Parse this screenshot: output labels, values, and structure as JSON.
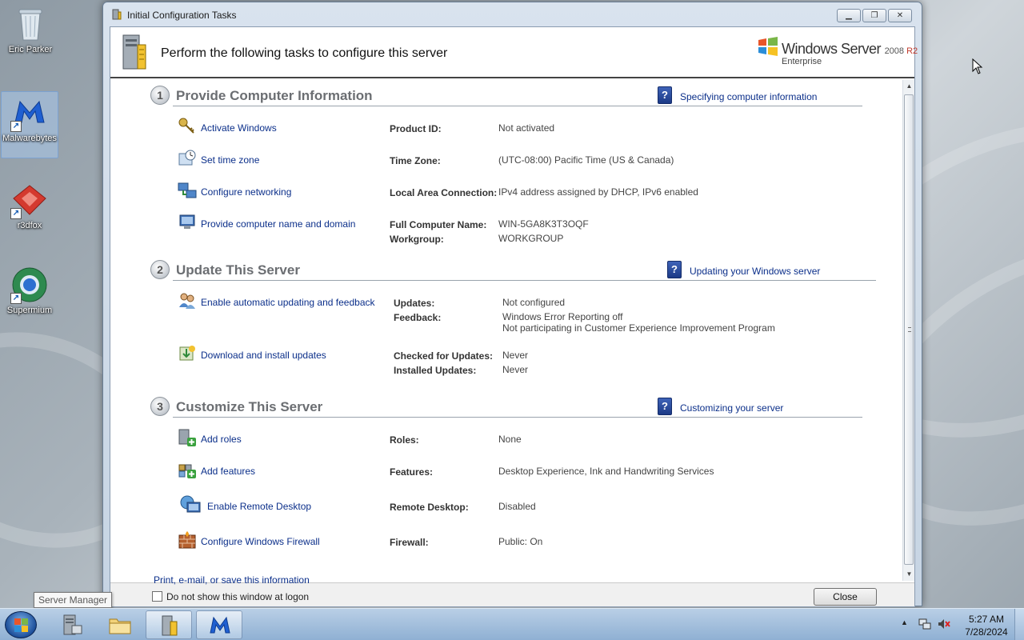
{
  "desktop": {
    "icons": [
      {
        "label": "Eric Parker",
        "icon": "recycle-bin-icon"
      },
      {
        "label": "Malwarebytes",
        "icon": "malwarebytes-icon"
      },
      {
        "label": "r3dfox",
        "icon": "r3dfox-icon"
      },
      {
        "label": "Supermium",
        "icon": "supermium-icon"
      }
    ]
  },
  "window": {
    "title": "Initial Configuration Tasks",
    "heading": "Perform the following tasks to configure this server",
    "brand": {
      "name": "Windows Server",
      "version_prefix": "2008",
      "version_suffix": "R2",
      "edition": "Enterprise"
    },
    "sections": [
      {
        "number": "1",
        "title": "Provide Computer Information",
        "help_link": "Specifying computer information",
        "tasks": [
          {
            "link": "Activate Windows",
            "icon": "keys-icon",
            "props": [
              {
                "label": "Product ID:",
                "value": "Not activated"
              }
            ]
          },
          {
            "link": "Set time zone",
            "icon": "clock-icon",
            "props": [
              {
                "label": "Time Zone:",
                "value": "(UTC-08:00) Pacific Time (US & Canada)"
              }
            ]
          },
          {
            "link": "Configure networking",
            "icon": "network-icon",
            "props": [
              {
                "label": "Local Area Connection:",
                "value": "IPv4 address assigned by DHCP, IPv6 enabled"
              }
            ]
          },
          {
            "link": "Provide computer name and domain",
            "icon": "computer-icon",
            "props": [
              {
                "label": "Full Computer Name:",
                "value": "WIN-5GA8K3T3OQF"
              },
              {
                "label": "Workgroup:",
                "value": "WORKGROUP"
              }
            ]
          }
        ]
      },
      {
        "number": "2",
        "title": "Update This Server",
        "help_link": "Updating your Windows server",
        "tasks": [
          {
            "link": "Enable automatic updating and feedback",
            "icon": "users-update-icon",
            "props": [
              {
                "label": "Updates:",
                "value": "Not configured"
              },
              {
                "label": "Feedback:",
                "value": "Windows Error Reporting off"
              }
            ],
            "extra": "Not participating in Customer Experience Improvement Program"
          },
          {
            "link": "Download and install updates",
            "icon": "download-updates-icon",
            "props": [
              {
                "label": "Checked for Updates:",
                "value": "Never"
              },
              {
                "label": "Installed Updates:",
                "value": "Never"
              }
            ]
          }
        ]
      },
      {
        "number": "3",
        "title": "Customize This Server",
        "help_link": "Customizing your server",
        "tasks": [
          {
            "link": "Add roles",
            "icon": "add-roles-icon",
            "props": [
              {
                "label": "Roles:",
                "value": "None"
              }
            ]
          },
          {
            "link": "Add features",
            "icon": "add-features-icon",
            "props": [
              {
                "label": "Features:",
                "value": "Desktop Experience, Ink and Handwriting Services"
              }
            ]
          },
          {
            "link": "Enable Remote Desktop",
            "icon": "remote-desktop-icon",
            "props": [
              {
                "label": "Remote Desktop:",
                "value": "Disabled"
              }
            ]
          },
          {
            "link": "Configure Windows Firewall",
            "icon": "firewall-icon",
            "props": [
              {
                "label": "Firewall:",
                "value": "Public: On"
              }
            ]
          }
        ]
      }
    ],
    "footer_link": "Print, e-mail, or save this information",
    "checkbox_label": "Do not show this window at logon",
    "close_label": "Close"
  },
  "tooltip": "Server Manager",
  "taskbar": {
    "clock_time": "5:27 AM",
    "clock_date": "7/28/2024"
  },
  "colors": {
    "link": "#0b2f8a",
    "section_title": "#6b6e72",
    "taskbar": "#a6c1de"
  }
}
